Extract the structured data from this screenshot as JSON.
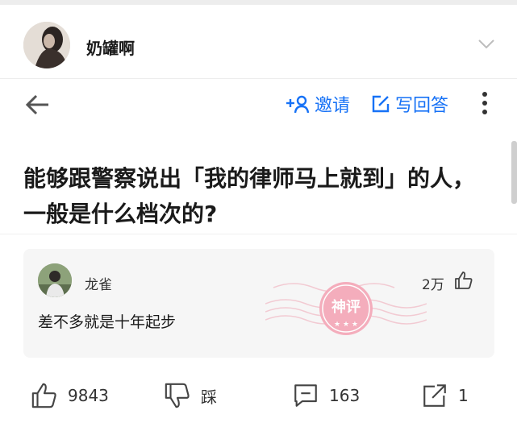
{
  "author": {
    "name": "奶罐啊",
    "avatar_icon": "profile-avatar"
  },
  "nav": {
    "back_icon": "arrow-left-icon",
    "invite_label": "邀请",
    "write_answer_label": "写回答",
    "more_icon": "more-vertical-icon"
  },
  "question": {
    "title": "能够跟警察说出「我的律师马上就到」的人，一般是什么档次的?"
  },
  "featured_comment": {
    "user": "龙雀",
    "likes": "2万",
    "text": "差不多就是十年起步",
    "stamp_text": "神评"
  },
  "actions": {
    "upvote_count": "9843",
    "downvote_label": "踩",
    "comment_count": "163",
    "share_count": "1"
  },
  "colors": {
    "accent": "#1772f6",
    "stamp": "#f08ca0",
    "card_bg": "#f6f6f6"
  }
}
